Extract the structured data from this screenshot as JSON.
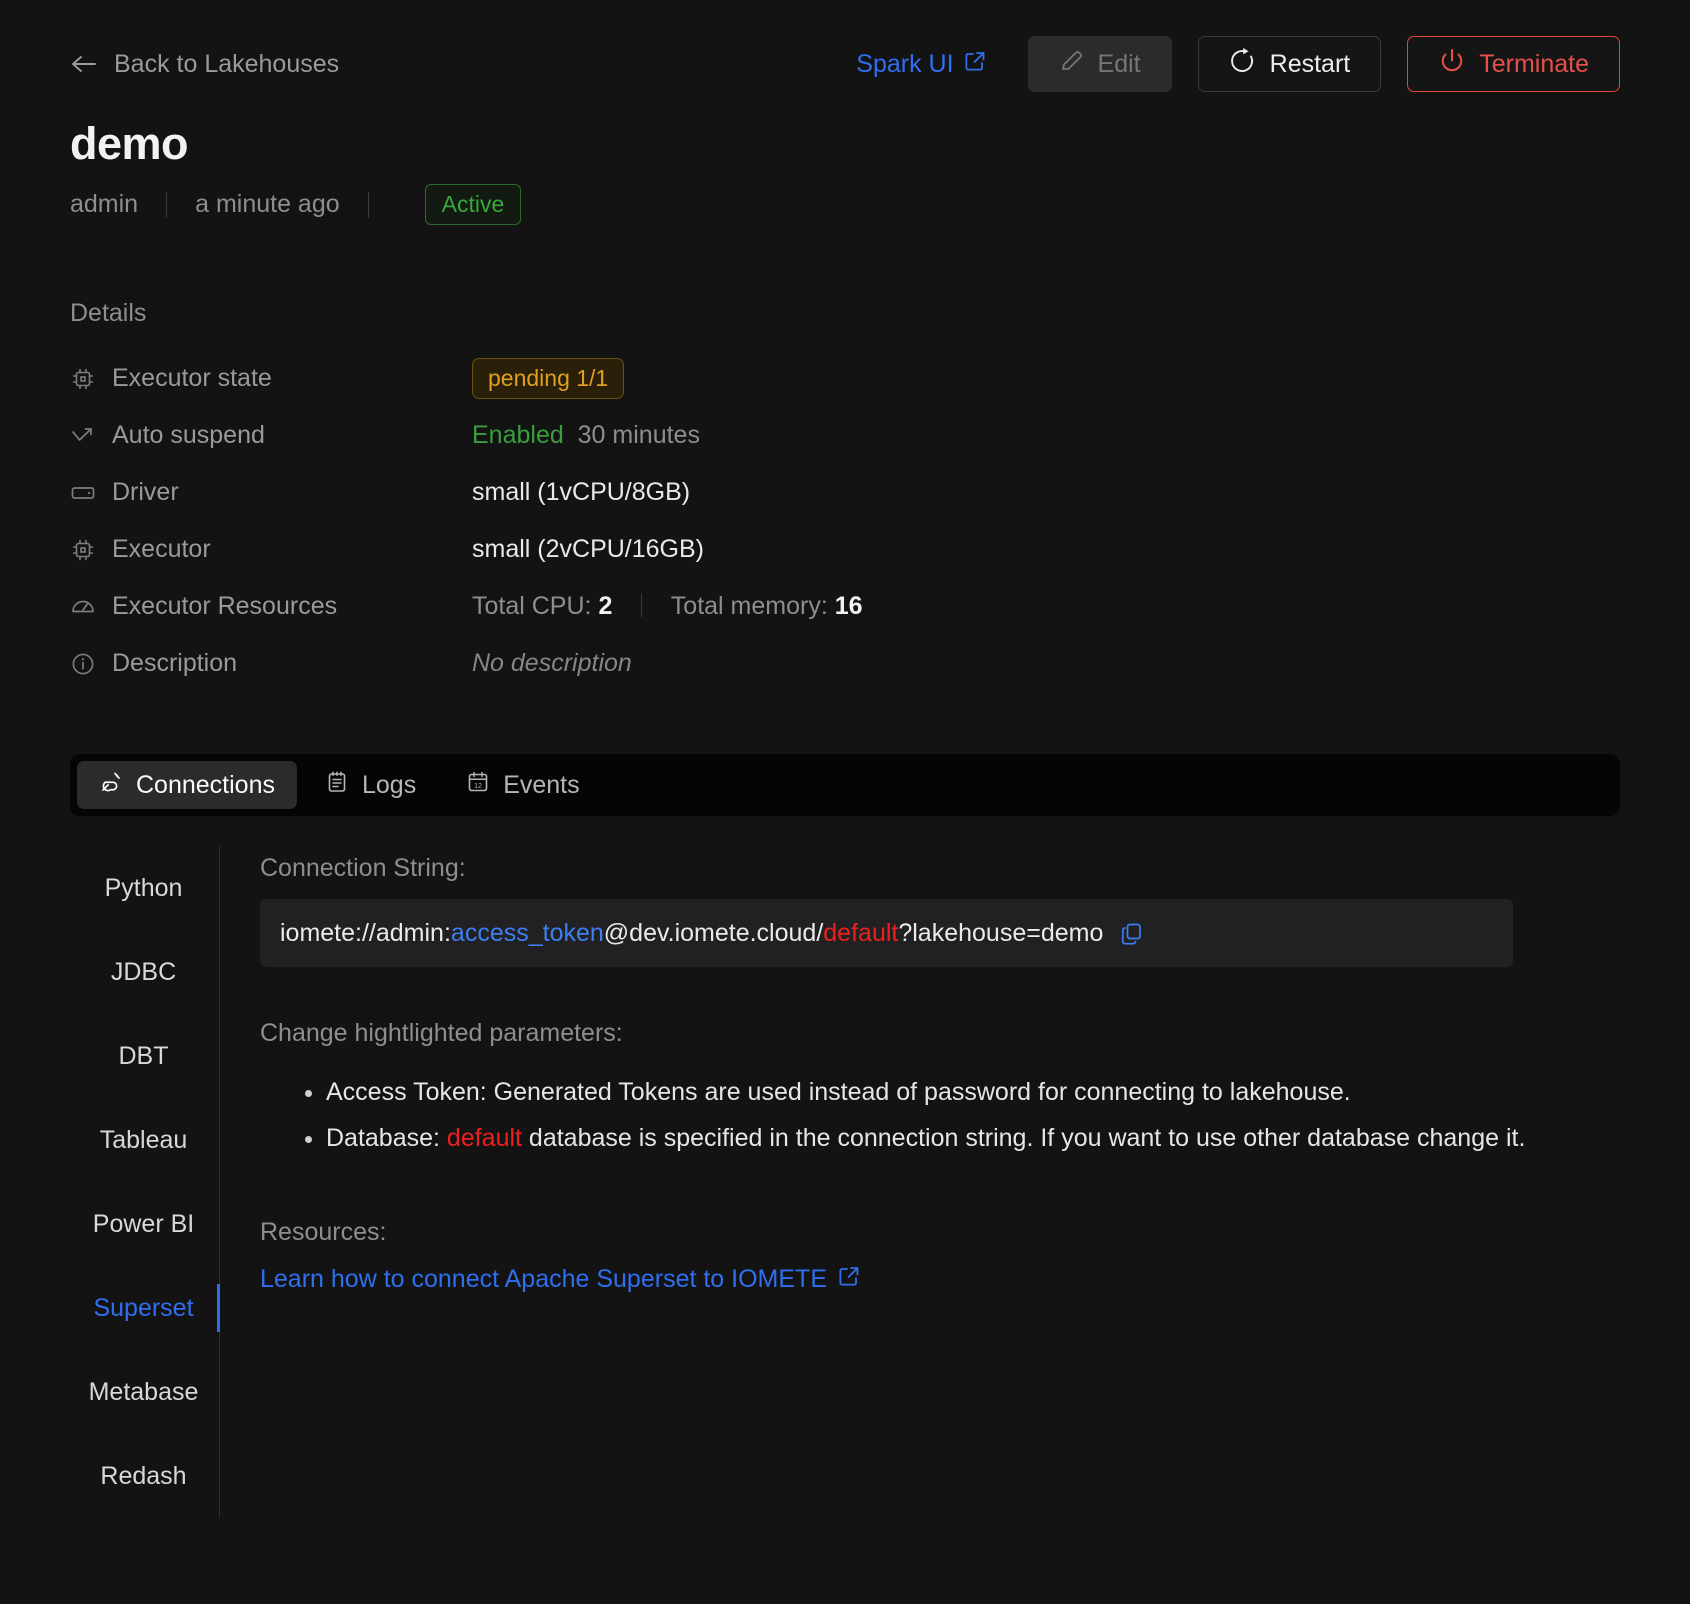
{
  "topbar": {
    "back_label": "Back to Lakehouses",
    "back_icon": "arrow-left-icon",
    "spark_ui_label": "Spark UI",
    "spark_ui_icon": "external-link-icon",
    "edit_label": "Edit",
    "edit_icon": "pencil-icon",
    "restart_label": "Restart",
    "restart_icon": "restart-power-icon",
    "terminate_label": "Terminate",
    "terminate_icon": "power-icon",
    "accent_blue": "#2f6fed",
    "danger_red": "#e5514a"
  },
  "header": {
    "title": "demo",
    "owner": "admin",
    "updated": "a minute ago",
    "status": "Active",
    "status_color": "#38a63a"
  },
  "details": {
    "heading": "Details",
    "rows": [
      {
        "icon": "cpu-chip-icon",
        "label": "Executor state",
        "badge": "pending 1/1",
        "badge_color": "#e0a020"
      },
      {
        "icon": "arrow-trend-icon",
        "label": "Auto suspend",
        "value_a": "Enabled",
        "value_b": "30 minutes"
      },
      {
        "icon": "server-icon",
        "label": "Driver",
        "value": "small (1vCPU/8GB)"
      },
      {
        "icon": "cpu-chip-icon",
        "label": "Executor",
        "value": "small (2vCPU/16GB)"
      },
      {
        "icon": "gauge-icon",
        "label": "Executor Resources",
        "cpu_label": "Total CPU:",
        "cpu_value": "2",
        "mem_label": "Total memory:",
        "mem_value": "16"
      },
      {
        "icon": "info-icon",
        "label": "Description",
        "value": "No description"
      }
    ]
  },
  "tabs": [
    {
      "label": "Connections",
      "icon": "plug-icon",
      "active": true
    },
    {
      "label": "Logs",
      "icon": "notepad-icon",
      "active": false
    },
    {
      "label": "Events",
      "icon": "calendar-icon",
      "active": false
    }
  ],
  "connections": {
    "sidebar": [
      {
        "label": "Python",
        "active": false
      },
      {
        "label": "JDBC",
        "active": false
      },
      {
        "label": "DBT",
        "active": false
      },
      {
        "label": "Tableau",
        "active": false
      },
      {
        "label": "Power BI",
        "active": false
      },
      {
        "label": "Superset",
        "active": true
      },
      {
        "label": "Metabase",
        "active": false
      },
      {
        "label": "Redash",
        "active": false
      }
    ],
    "connection_string_label": "Connection String:",
    "connection_string": {
      "prefix": "iomete://admin:",
      "token": "access_token",
      "middle": "@dev.iomete.cloud/",
      "database": "default",
      "suffix": "?lakehouse=demo",
      "copy_icon": "copy-icon"
    },
    "change_heading": "Change hightlighted parameters:",
    "notes": [
      {
        "prefix": "Access Token: Generated Tokens are used instead of password for connecting to lakehouse.",
        "highlight": "",
        "suffix": ""
      },
      {
        "prefix": "Database: ",
        "highlight": "default",
        "suffix": " database is specified in the connection string. If you want to use other database change it."
      }
    ],
    "resources_heading": "Resources:",
    "resource_link": "Learn how to connect Apache Superset to IOMETE",
    "resource_link_icon": "external-link-icon"
  }
}
